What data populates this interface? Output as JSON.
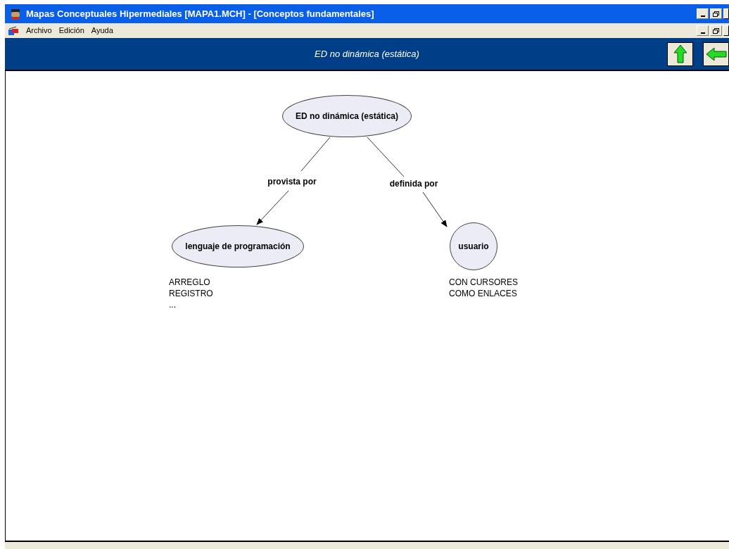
{
  "window": {
    "title": "Mapas Conceptuales Hipermediales [MAPA1.MCH] - [Conceptos fundamentales]"
  },
  "menu": [
    "Archivo",
    "Edición",
    "Ayuda"
  ],
  "header": {
    "title": "ED no dinámica (estática)"
  },
  "nodes": [
    {
      "kind": "ellipse",
      "text": "ED no dinámica (estática)"
    },
    {
      "kind": "ellipse",
      "text": "lenguaje de programación"
    },
    {
      "kind": "circle",
      "text": "usuario"
    }
  ],
  "links": [
    {
      "label": "provista por"
    },
    {
      "label": "definida por"
    }
  ],
  "notes": [
    {
      "lines": [
        "ARREGLO",
        "REGISTRO",
        "..."
      ]
    },
    {
      "lines": [
        "CON CURSORES",
        "COMO ENLACES"
      ]
    }
  ]
}
